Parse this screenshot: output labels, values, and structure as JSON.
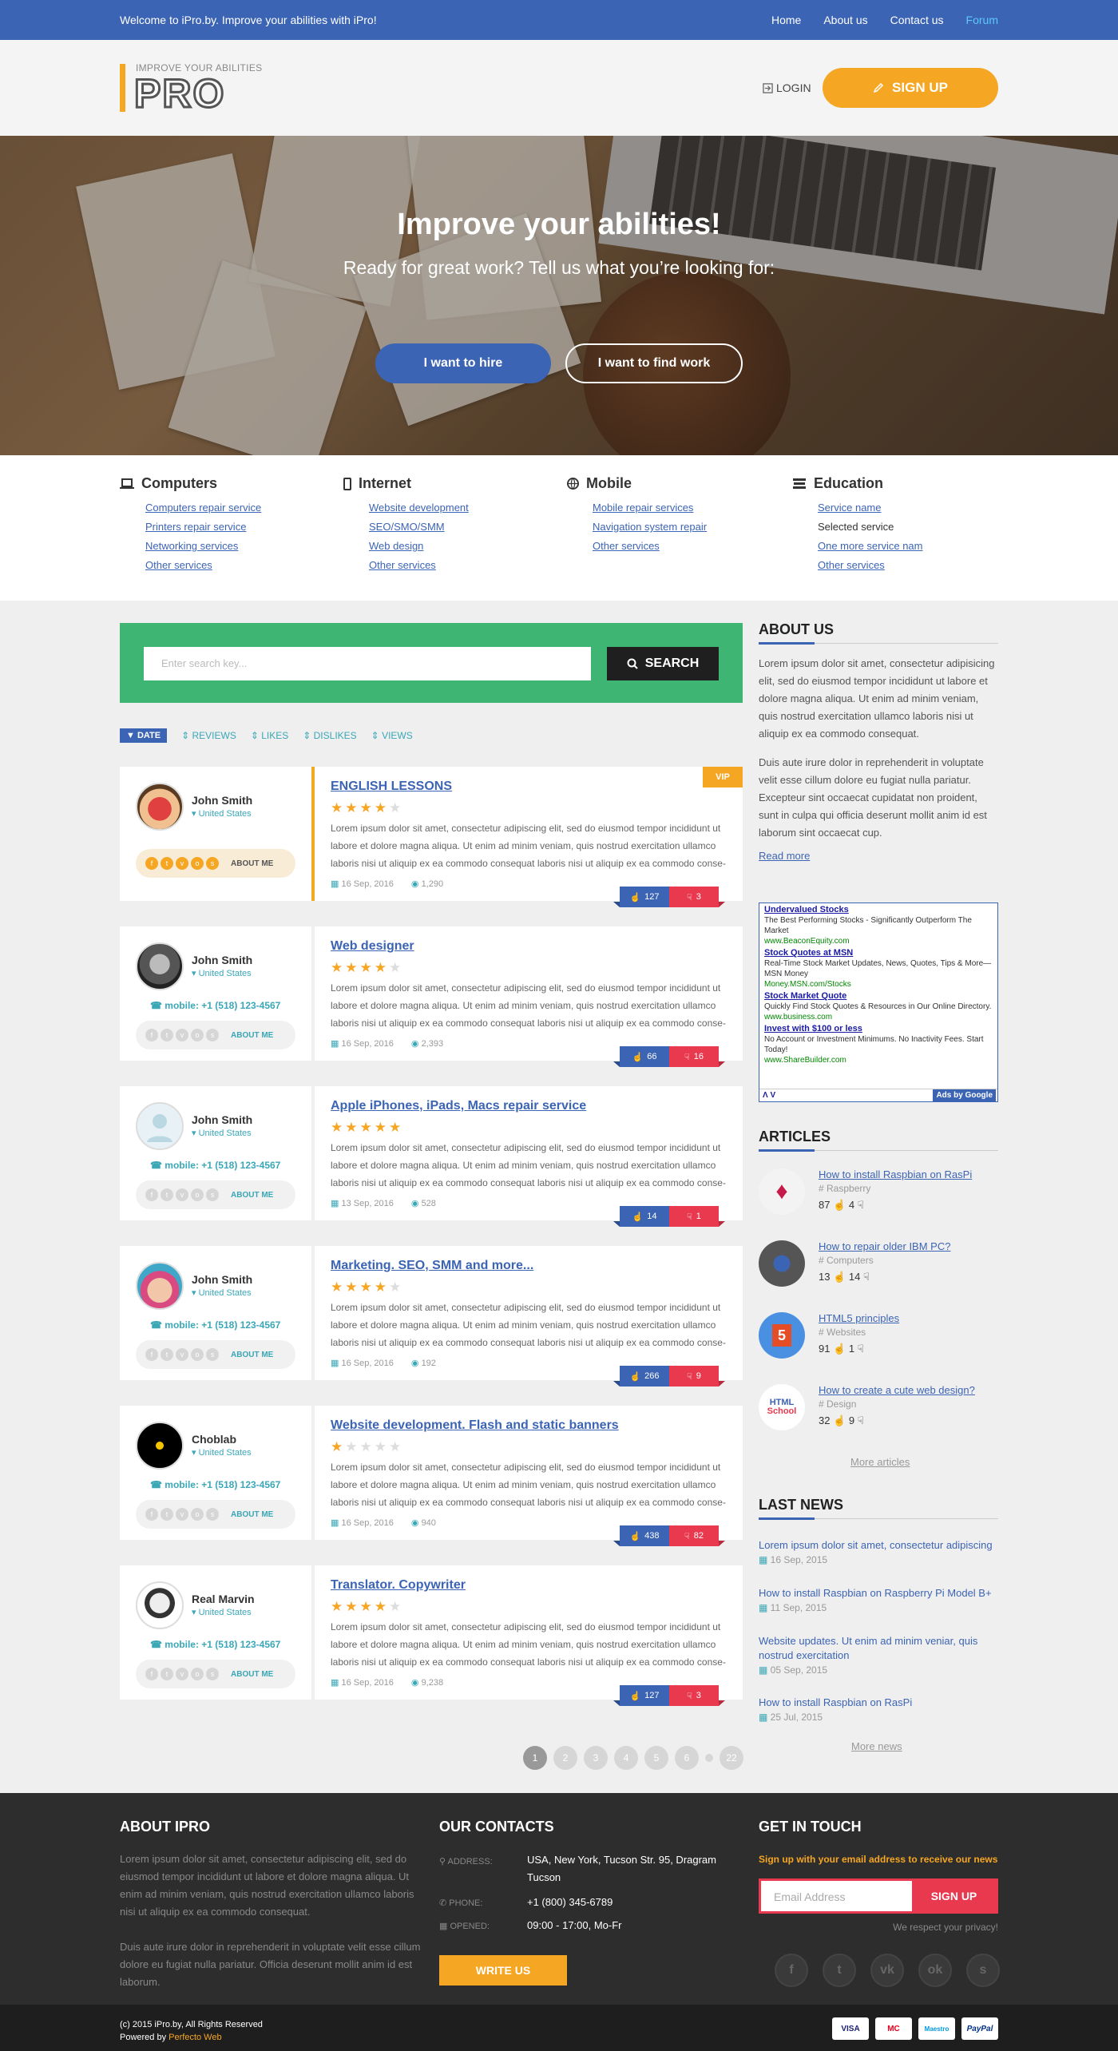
{
  "topbar": {
    "welcome": "Welcome to iPro.by. Improve your abilities with iPro!",
    "nav": [
      "Home",
      "About us",
      "Contact us",
      "Forum"
    ],
    "active": "Forum"
  },
  "header": {
    "logo_small": "IMPROVE YOUR ABILITIES",
    "logo_big": "PRO",
    "login": "LOGIN",
    "signup": "SIGN UP"
  },
  "hero": {
    "title": "Improve your abilities!",
    "subtitle": "Ready for great work? Tell us what you’re looking for:",
    "hire": "I want to hire",
    "work": "I want to find work"
  },
  "categories": [
    {
      "title": "Computers",
      "icon": "laptop-icon",
      "items": [
        "Computers repair service",
        "Printers repair service",
        "Networking services",
        "Other services"
      ]
    },
    {
      "title": "Internet",
      "icon": "phone-icon",
      "items": [
        "Website development",
        "SEO/SMO/SMM",
        "Web design",
        "Other services"
      ]
    },
    {
      "title": "Mobile",
      "icon": "globe-icon",
      "items": [
        "Mobile repair services",
        "Navigation system repair",
        "Other services"
      ]
    },
    {
      "title": "Education",
      "icon": "books-icon",
      "items": [
        "Service name",
        "Selected service",
        "One more service nam",
        "Other services"
      ]
    }
  ],
  "search": {
    "placeholder": "Enter search key...",
    "button": "SEARCH"
  },
  "sort": [
    "DATE",
    "REVIEWS",
    "LIKES",
    "DISLIKES",
    "VIEWS"
  ],
  "listings": [
    {
      "name": "John Smith",
      "location": "United States",
      "mobile": "",
      "about": "ABOUT ME",
      "title": "ENGLISH LESSONS",
      "rating": 4,
      "vip": "VIP",
      "date": "16 Sep, 2016",
      "views": "1,290",
      "likes": "127",
      "dislikes": "3"
    },
    {
      "name": "John Smith",
      "location": "United States",
      "mobile": "mobile: +1 (518) 123-4567",
      "about": "ABOUT ME",
      "title": "Web designer",
      "rating": 4,
      "vip": "",
      "date": "16 Sep, 2016",
      "views": "2,393",
      "likes": "66",
      "dislikes": "16"
    },
    {
      "name": "John Smith",
      "location": "United States",
      "mobile": "mobile: +1 (518) 123-4567",
      "about": "ABOUT ME",
      "title": "Apple iPhones, iPads, Macs repair service",
      "rating": 5,
      "vip": "",
      "date": "13 Sep, 2016",
      "views": "528",
      "likes": "14",
      "dislikes": "1"
    },
    {
      "name": "John Smith",
      "location": "United States",
      "mobile": "mobile: +1 (518) 123-4567",
      "about": "ABOUT ME",
      "title": "Marketing. SEO, SMM and more...",
      "rating": 4,
      "vip": "",
      "date": "16 Sep, 2016",
      "views": "192",
      "likes": "266",
      "dislikes": "9"
    },
    {
      "name": "Choblab",
      "location": "United States",
      "mobile": "mobile: +1 (518) 123-4567",
      "about": "ABOUT ME",
      "title": "Website development. Flash and static banners",
      "rating": 1,
      "vip": "",
      "date": "16 Sep, 2016",
      "views": "940",
      "likes": "438",
      "dislikes": "82"
    },
    {
      "name": "Real Marvin",
      "location": "United States",
      "mobile": "mobile: +1 (518) 123-4567",
      "about": "ABOUT ME",
      "title": "Translator. Copywriter",
      "rating": 4,
      "vip": "",
      "date": "16 Sep, 2016",
      "views": "9,238",
      "likes": "127",
      "dislikes": "3"
    }
  ],
  "lorem": "Lorem ipsum dolor sit amet, consectetur adipiscing elit, sed do eiusmod tempor incididunt ut labore et dolore magna aliqua. Ut enim ad minim veniam, quis nostrud exercitation ullamco laboris nisi ut aliquip ex ea commodo consequat laboris nisi ut aliquip ex ea commodo conse-",
  "pagination": [
    "1",
    "2",
    "3",
    "4",
    "5",
    "6",
    "22"
  ],
  "sidebar": {
    "about_title": "ABOUT US",
    "about_p1": "Lorem ipsum dolor sit amet, consectetur adipisicing elit, sed do eiusmod tempor incididunt ut labore et dolore magna aliqua. Ut enim ad minim veniam, quis nostrud exercitation ullamco laboris nisi ut aliquip ex ea commodo consequat.",
    "about_p2": "Duis aute irure dolor in reprehenderit in voluptate velit esse cillum dolore eu fugiat nulla pariatur. Excepteur sint occaecat cupidatat non proident, sunt in culpa qui officia deserunt mollit anim id est laborum sint occaecat cup.",
    "read_more": "Read more",
    "ads": [
      {
        "t": "Undervalued Stocks",
        "d": "The Best Performing Stocks - Significantly Outperform The Market",
        "u": "www.BeaconEquity.com"
      },
      {
        "t": "Stock Quotes at MSN",
        "d": "Real-Time Stock Market Updates, News, Quotes, Tips & More—MSN Money",
        "u": "Money.MSN.com/Stocks"
      },
      {
        "t": "Stock Market Quote",
        "d": "Quickly Find Stock Quotes & Resources in Our Online Directory.",
        "u": "www.business.com"
      },
      {
        "t": "Invest with $100 or less",
        "d": "No Account or Investment Minimums. No Inactivity Fees. Start Today!",
        "u": "www.ShareBuilder.com"
      }
    ],
    "ads_footer": "Ads by Google",
    "ads_nav": "Λ V",
    "articles_title": "ARTICLES",
    "articles": [
      {
        "title": "How to install Raspbian on RasPi",
        "tag": "# Raspberry",
        "likes": "87",
        "dislikes": "4"
      },
      {
        "title": "How to repair older IBM PC?",
        "tag": "# Computers",
        "likes": "13",
        "dislikes": "14"
      },
      {
        "title": "HTML5 principles",
        "tag": "# Websites",
        "likes": "91",
        "dislikes": "1"
      },
      {
        "title": "How to create a cute web design?",
        "tag": "# Design",
        "likes": "32",
        "dislikes": "9"
      }
    ],
    "more_articles": "More articles",
    "news_title": "LAST NEWS",
    "news": [
      {
        "title": "Lorem ipsum dolor sit amet, consectetur adipiscing",
        "date": "16 Sep, 2015"
      },
      {
        "title": "How to install Raspbian on Raspberry Pi Model B+",
        "date": "11 Sep, 2015"
      },
      {
        "title": "Website updates. Ut enim ad minim veniar, quis nostrud exercitation",
        "date": "05 Sep, 2015"
      },
      {
        "title": "How to install Raspbian on RasPi",
        "date": "25 Jul, 2015"
      }
    ],
    "more_news": "More news"
  },
  "footer": {
    "about_title": "ABOUT IPRO",
    "about_p1": "Lorem ipsum dolor sit amet, consectetur adipiscing elit, sed do eiusmod tempor incididunt ut labore et dolore magna aliqua. Ut enim ad minim veniam, quis nostrud exercitation ullamco laboris nisi ut aliquip ex ea commodo consequat.",
    "about_p2": "Duis aute irure dolor in reprehenderit in voluptate velit esse cillum dolore eu fugiat nulla pariatur. Officia deserunt mollit anim id est laborum.",
    "contacts_title": "OUR CONTACTS",
    "address_label": "ADDRESS:",
    "address": "USA, New York, Tucson Str. 95, Dragram Tucson",
    "phone_label": "PHONE:",
    "phone": "+1 (800) 345-6789",
    "opened_label": "OPENED:",
    "opened": "09:00 - 17:00, Mo-Fr",
    "write_us": "WRITE US",
    "touch_title": "GET IN TOUCH",
    "newsletter_label": "Sign up with your email address to receive our news",
    "email_placeholder": "Email Address",
    "email_button": "SIGN UP",
    "privacy": "We respect your privacy!",
    "social": [
      "f",
      "t",
      "vk",
      "ok",
      "s"
    ],
    "copyright": "(c) 2015 iPro.by, All Rights Reserved",
    "powered_prefix": "Powered by ",
    "powered_name": "Perfecto Web",
    "payments": [
      "VISA",
      "MC",
      "Maestro",
      "PayPal"
    ]
  },
  "colors": {
    "primary": "#3c64b4",
    "accent": "#f5a623",
    "green": "#3fb574",
    "red": "#e8394f",
    "teal": "#3aa7b6"
  }
}
